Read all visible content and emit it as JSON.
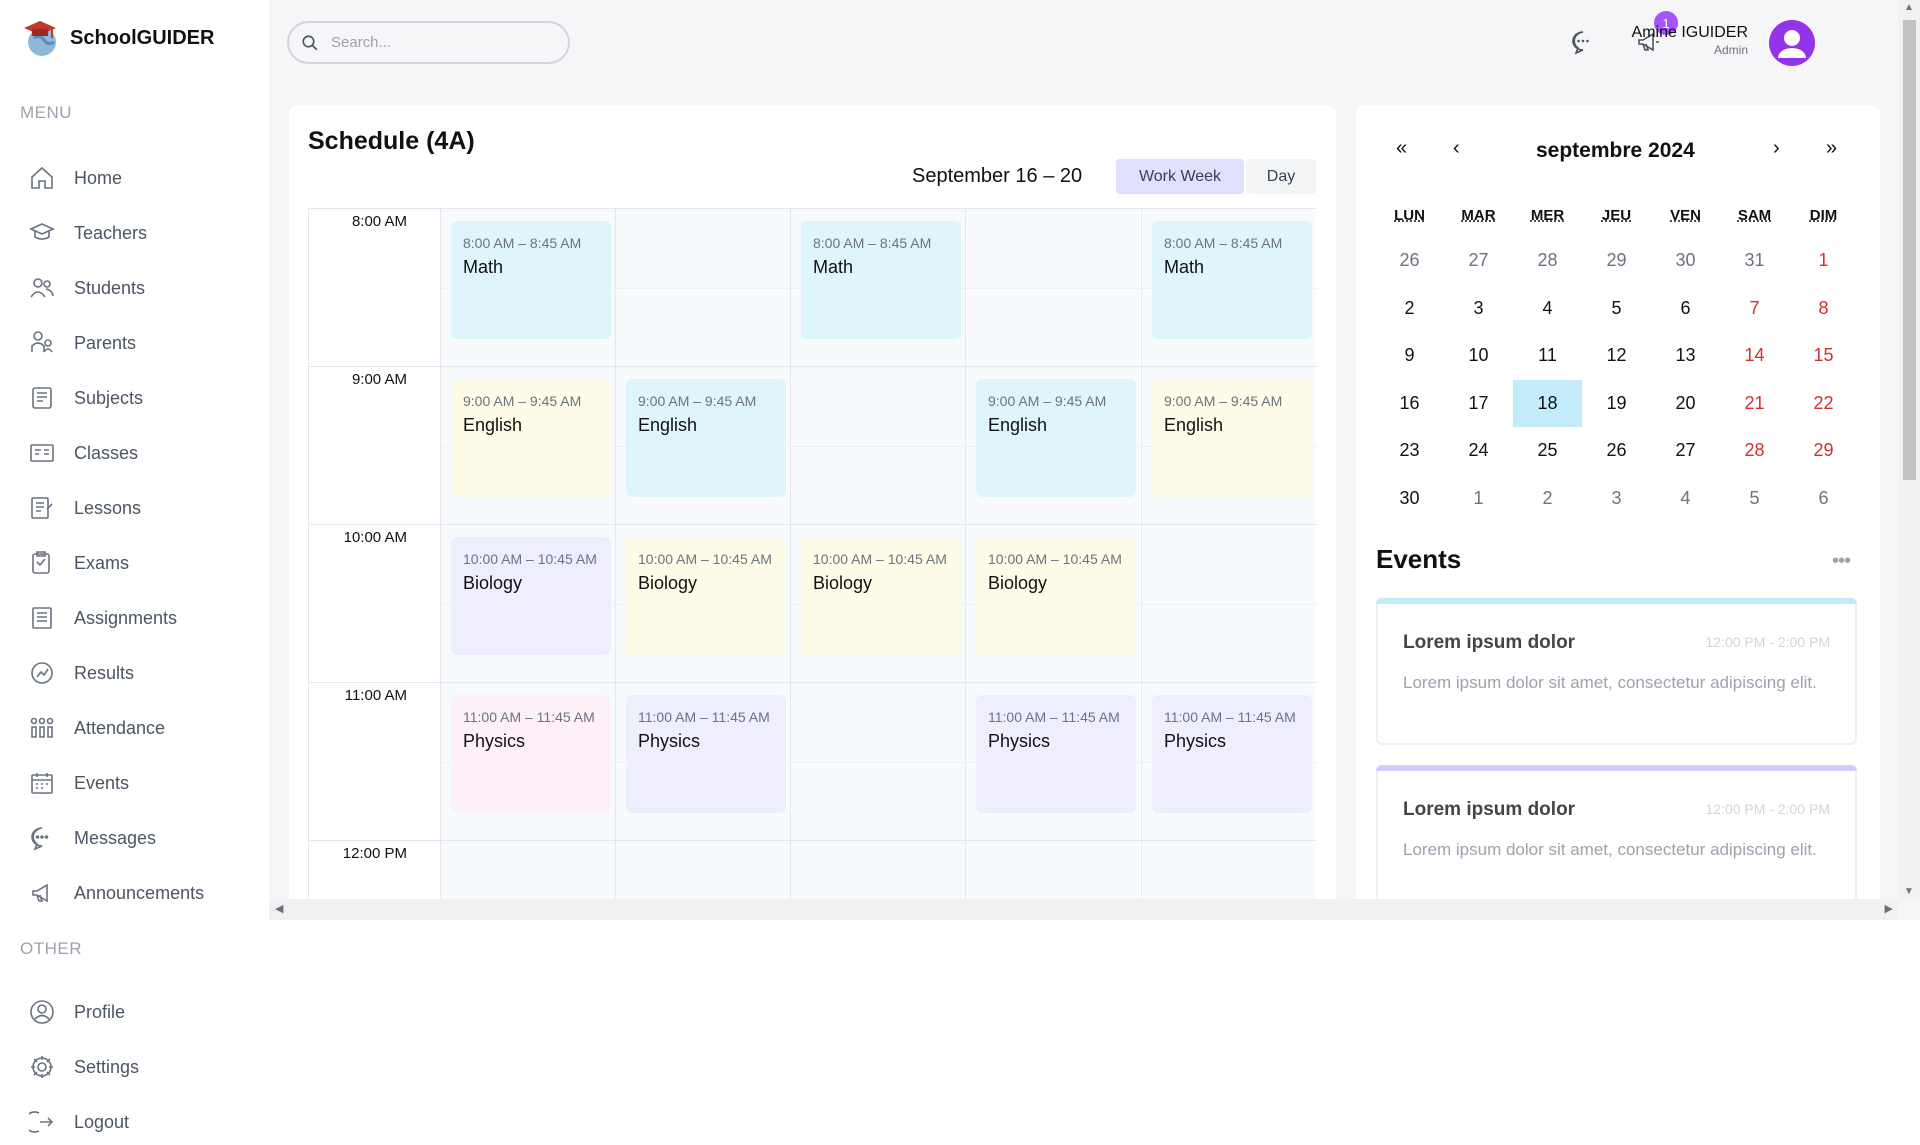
{
  "app": {
    "name": "SchoolGUIDER"
  },
  "sidebar": {
    "menu_title": "MENU",
    "other_title": "OTHER",
    "menu_items": [
      {
        "label": "Home",
        "icon": "home-icon"
      },
      {
        "label": "Teachers",
        "icon": "teacher-icon"
      },
      {
        "label": "Students",
        "icon": "students-icon"
      },
      {
        "label": "Parents",
        "icon": "parents-icon"
      },
      {
        "label": "Subjects",
        "icon": "subjects-icon"
      },
      {
        "label": "Classes",
        "icon": "classes-icon"
      },
      {
        "label": "Lessons",
        "icon": "lessons-icon"
      },
      {
        "label": "Exams",
        "icon": "exams-icon"
      },
      {
        "label": "Assignments",
        "icon": "assignments-icon"
      },
      {
        "label": "Results",
        "icon": "results-icon"
      },
      {
        "label": "Attendance",
        "icon": "attendance-icon"
      },
      {
        "label": "Events",
        "icon": "events-icon"
      },
      {
        "label": "Messages",
        "icon": "messages-icon"
      },
      {
        "label": "Announcements",
        "icon": "announcements-icon"
      }
    ],
    "other_items": [
      {
        "label": "Profile",
        "icon": "profile-icon"
      },
      {
        "label": "Settings",
        "icon": "settings-icon"
      },
      {
        "label": "Logout",
        "icon": "logout-icon"
      }
    ]
  },
  "header": {
    "search_placeholder": "Search...",
    "notification_count": "1",
    "user_name": "Amine IGUIDER",
    "user_role": "Admin"
  },
  "schedule": {
    "title": "Schedule (4A)",
    "range": "September 16 – 20",
    "views": [
      "Work Week",
      "Day"
    ],
    "active_view": "Work Week",
    "times": [
      "8:00 AM",
      "9:00 AM",
      "10:00 AM",
      "11:00 AM",
      "12:00 PM"
    ],
    "events": [
      {
        "day": 0,
        "slot": 0,
        "time": "8:00 AM – 8:45 AM",
        "subject": "Math",
        "color": "sky"
      },
      {
        "day": 2,
        "slot": 0,
        "time": "8:00 AM – 8:45 AM",
        "subject": "Math",
        "color": "sky"
      },
      {
        "day": 4,
        "slot": 0,
        "time": "8:00 AM – 8:45 AM",
        "subject": "Math",
        "color": "sky"
      },
      {
        "day": 0,
        "slot": 1,
        "time": "9:00 AM – 9:45 AM",
        "subject": "English",
        "color": "yellow"
      },
      {
        "day": 1,
        "slot": 1,
        "time": "9:00 AM – 9:45 AM",
        "subject": "English",
        "color": "sky"
      },
      {
        "day": 3,
        "slot": 1,
        "time": "9:00 AM – 9:45 AM",
        "subject": "English",
        "color": "sky"
      },
      {
        "day": 4,
        "slot": 1,
        "time": "9:00 AM – 9:45 AM",
        "subject": "English",
        "color": "yellow"
      },
      {
        "day": 0,
        "slot": 2,
        "time": "10:00 AM – 10:45 AM",
        "subject": "Biology",
        "color": "purple"
      },
      {
        "day": 1,
        "slot": 2,
        "time": "10:00 AM – 10:45 AM",
        "subject": "Biology",
        "color": "yellow"
      },
      {
        "day": 2,
        "slot": 2,
        "time": "10:00 AM – 10:45 AM",
        "subject": "Biology",
        "color": "yellow"
      },
      {
        "day": 3,
        "slot": 2,
        "time": "10:00 AM – 10:45 AM",
        "subject": "Biology",
        "color": "yellow"
      },
      {
        "day": 0,
        "slot": 3,
        "time": "11:00 AM – 11:45 AM",
        "subject": "Physics",
        "color": "pink"
      },
      {
        "day": 1,
        "slot": 3,
        "time": "11:00 AM – 11:45 AM",
        "subject": "Physics",
        "color": "purple"
      },
      {
        "day": 3,
        "slot": 3,
        "time": "11:00 AM – 11:45 AM",
        "subject": "Physics",
        "color": "purple"
      },
      {
        "day": 4,
        "slot": 3,
        "time": "11:00 AM – 11:45 AM",
        "subject": "Physics",
        "color": "purple"
      }
    ]
  },
  "calendar": {
    "month_label": "septembre 2024",
    "nav": [
      "«",
      "‹",
      "›",
      "»"
    ],
    "weekdays": [
      "LUN",
      "MAR",
      "MER",
      "JEU",
      "VEN",
      "SAM",
      "DIM"
    ],
    "selected": "18",
    "weeks": [
      [
        "26",
        "27",
        "28",
        "29",
        "30",
        "31",
        "1"
      ],
      [
        "2",
        "3",
        "4",
        "5",
        "6",
        "7",
        "8"
      ],
      [
        "9",
        "10",
        "11",
        "12",
        "13",
        "14",
        "15"
      ],
      [
        "16",
        "17",
        "18",
        "19",
        "20",
        "21",
        "22"
      ],
      [
        "23",
        "24",
        "25",
        "26",
        "27",
        "28",
        "29"
      ],
      [
        "30",
        "1",
        "2",
        "3",
        "4",
        "5",
        "6"
      ]
    ]
  },
  "events_panel": {
    "title": "Events",
    "more": "•••",
    "items": [
      {
        "title": "Lorem ipsum dolor",
        "time": "12:00 PM - 2:00 PM",
        "description": "Lorem ipsum dolor sit amet, consectetur adipiscing elit.",
        "accent": "#c3ebfa"
      },
      {
        "title": "Lorem ipsum dolor",
        "time": "12:00 PM - 2:00 PM",
        "description": "Lorem ipsum dolor sit amet, consectetur adipiscing elit.",
        "accent": "#cfceff"
      }
    ]
  },
  "colors": {
    "sky": "#c3ebfa",
    "purple": "#cfceff",
    "yellow": "#fae27c",
    "badge": "#a855f7"
  }
}
